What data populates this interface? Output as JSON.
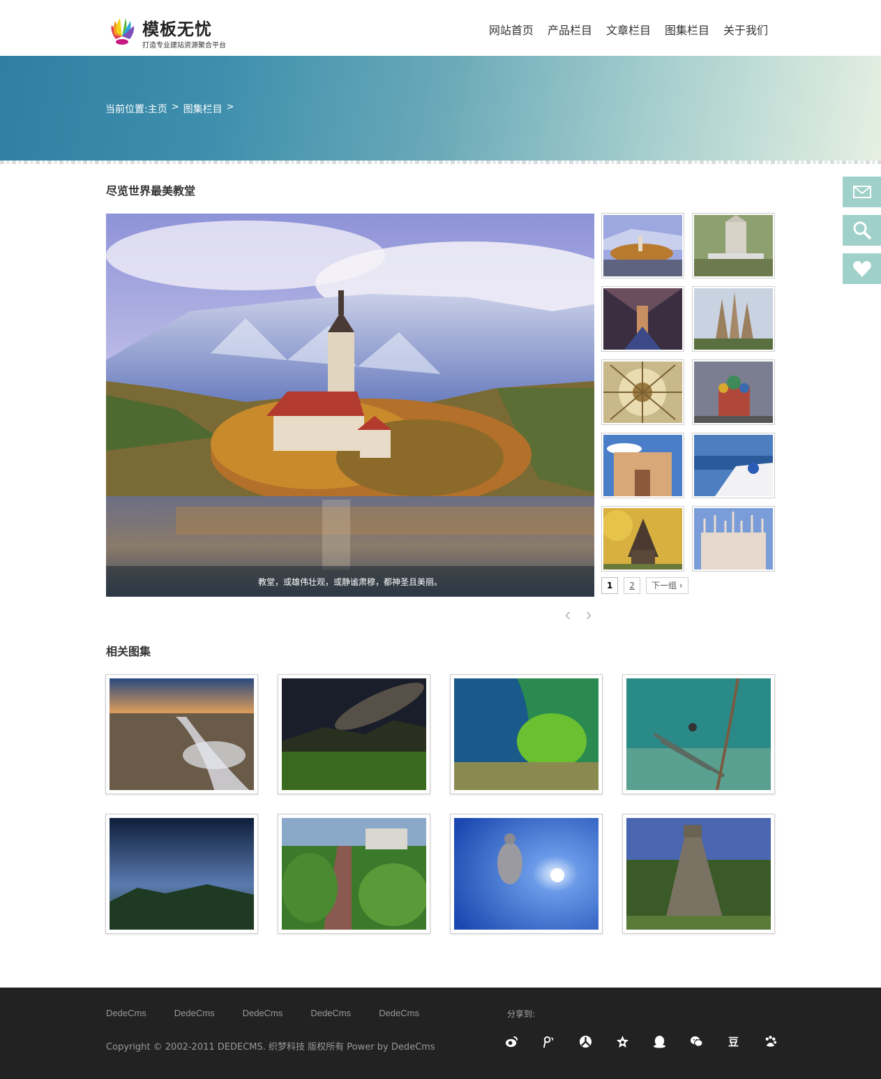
{
  "header": {
    "logo_name": "模板无忧",
    "logo_slogan": "打造专业建站资源聚合平台",
    "nav": [
      "网站首页",
      "产品栏目",
      "文章栏目",
      "图集栏目",
      "关于我们"
    ]
  },
  "breadcrumb": {
    "prefix": "当前位置:",
    "home": "主页",
    "sep": ">",
    "current": "图集栏目"
  },
  "side_tools": [
    {
      "icon": "mail-icon"
    },
    {
      "icon": "search-icon"
    },
    {
      "icon": "heart-icon"
    }
  ],
  "gallery": {
    "title": "尽览世界最美教堂",
    "caption": "教堂，或雄伟壮观，或静谧肃穆，都神圣且美丽。",
    "prev_arrow": "‹",
    "next_arrow": "›",
    "thumbnails_count": 10,
    "pager": [
      "1",
      "2",
      "下一组 ›"
    ]
  },
  "related": {
    "title": "相关图集",
    "count": 8
  },
  "footer": {
    "links": [
      "DedeCms",
      "DedeCms",
      "DedeCms",
      "DedeCms",
      "DedeCms"
    ],
    "copyright": "Copyright © 2002-2011 DEDECMS. 织梦科技 版权所有 Power by DedeCms",
    "share_label": "分享到:",
    "share_icons": [
      "weibo-icon",
      "tencent-weibo-icon",
      "renren-icon",
      "kaixin-icon",
      "qq-icon",
      "wechat-icon",
      "douban-icon",
      "baidu-icon"
    ],
    "douban_glyph": "豆"
  },
  "colors": {
    "accent_teal": "#9fd0c9",
    "footer_bg": "#222222",
    "banner_start": "#2f7fa3",
    "banner_end": "#e6f0e2"
  }
}
